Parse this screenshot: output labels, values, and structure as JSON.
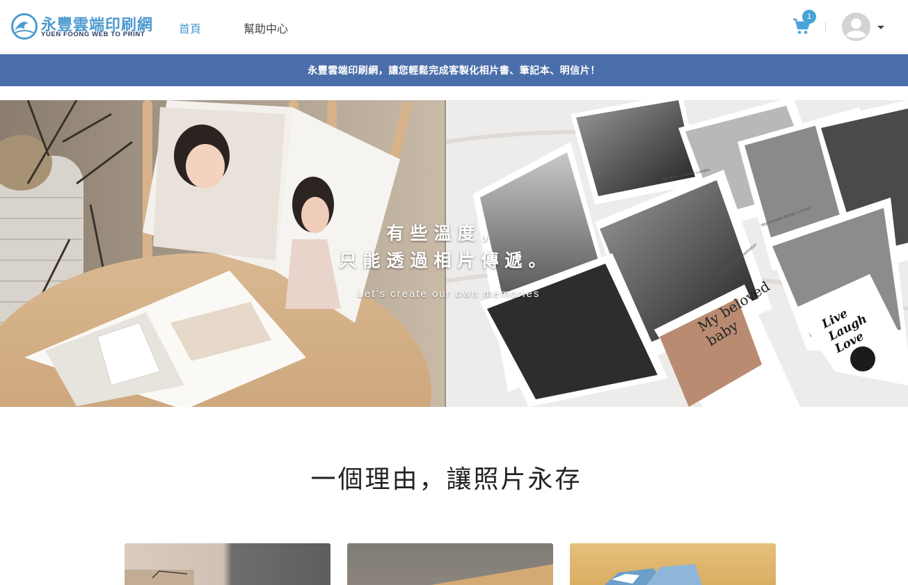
{
  "header": {
    "logo_cn": "永豐雲端印刷網",
    "logo_en": "YUEN FOONG WEB TO PRINT",
    "nav": [
      {
        "label": "首頁",
        "active": true
      },
      {
        "label": "幫助中心",
        "active": false
      }
    ],
    "cart_count": "1",
    "accent_color": "#4d9ad0"
  },
  "banner": {
    "text": "永豐雲端印刷網，讓您輕鬆完成客製化相片書、筆記本、明信片！",
    "color": "#4a6ea9"
  },
  "hero": {
    "line1": "有些溫度，",
    "line2": "只能透過相片傳遞。",
    "subtitle": "Let’s create our own memories",
    "photo_texts": {
      "card_baby": "My beloved baby",
      "card_live": "Live Laugh Love",
      "caption_thames": "The River Thames London",
      "caption_brooklyn": "Brooklyn Bridge, Manhattan",
      "caption_westminster": "Westminster Bridge, London"
    }
  },
  "section": {
    "title": "一個理由，讓照片永存"
  }
}
